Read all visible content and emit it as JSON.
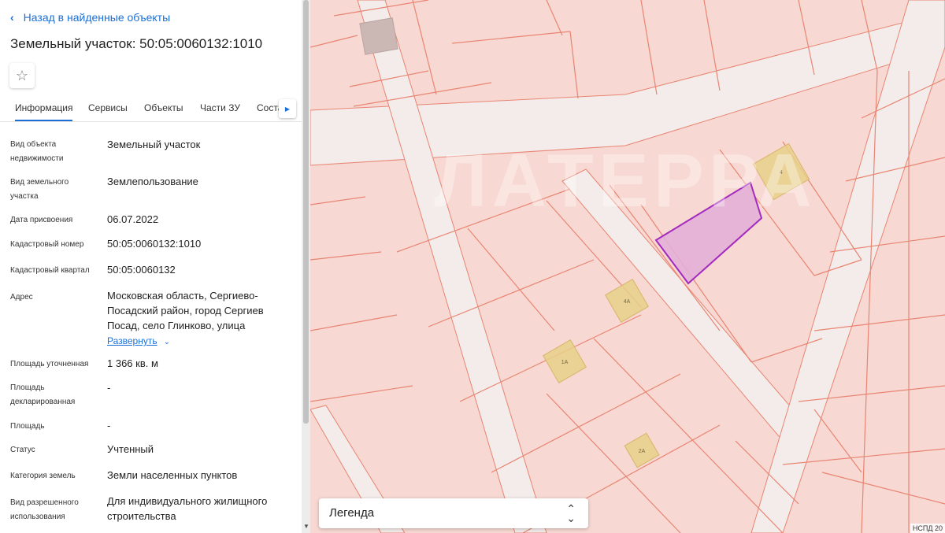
{
  "back_link": "Назад в найденные объекты",
  "title": "Земельный участок: 50:05:0060132:1010",
  "favorite_icon": "star-icon",
  "tabs": [
    "Информация",
    "Сервисы",
    "Объекты",
    "Части ЗУ",
    "Состав"
  ],
  "active_tab": "Информация",
  "fields": [
    {
      "label": "Вид объекта недвижимости",
      "value": "Земельный участок"
    },
    {
      "label": "Вид земельного участка",
      "value": "Землепользование"
    },
    {
      "label": "Дата присвоения",
      "value": "06.07.2022"
    },
    {
      "label": "Кадастровый номер",
      "value": "50:05:0060132:1010"
    },
    {
      "label": "Кадастровый квартал",
      "value": "50:05:0060132"
    },
    {
      "label": "Адрес",
      "value": "Московская область, Сергиево-Посадский район, город Сергиев Посад, село Глинково, улица"
    },
    {
      "label": "Площадь уточненная",
      "value": "1 366 кв. м"
    },
    {
      "label": "Площадь декларированная",
      "value": "-"
    },
    {
      "label": "Площадь",
      "value": "-"
    },
    {
      "label": "Статус",
      "value": "Учтенный"
    },
    {
      "label": "Категория земель",
      "value": "Земли населенных пунктов"
    },
    {
      "label": "Вид разрешенного использования",
      "value": "Для индивидуального жилищного строительства"
    }
  ],
  "expand_label": "Развернуть",
  "map": {
    "legend": "Легенда",
    "watermark": "ЛАТЕРРА",
    "copyright": "НСПД 20",
    "building_labels": [
      "4",
      "4А",
      "1А",
      "2А"
    ],
    "colors": {
      "parcel_fill": "#f7d8d2",
      "boundary": "#e88573",
      "road": "#f4ecea",
      "highlight_fill": "#e2b0d6",
      "highlight_stroke": "#a32bc0",
      "building": "#e8d08a"
    }
  }
}
